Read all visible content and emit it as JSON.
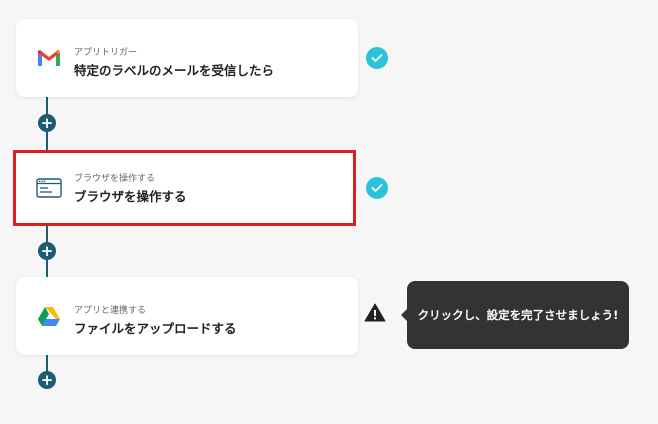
{
  "steps": [
    {
      "small_label": "アプリトリガー",
      "main_label": "特定のラベルのメールを受信したら",
      "icon": "gmail-icon",
      "status": "complete"
    },
    {
      "small_label": "ブラウザを操作する",
      "main_label": "ブラウザを操作する",
      "icon": "browser-window-icon",
      "status": "complete",
      "highlighted": true
    },
    {
      "small_label": "アプリと連携する",
      "main_label": "ファイルをアップロードする",
      "icon": "google-drive-icon",
      "status": "warning"
    }
  ],
  "add_step_symbol": "+",
  "tooltip": {
    "text": "クリックし、設定を完了させましょう!"
  },
  "colors": {
    "check": "#2bc3d9",
    "connector": "#1c5d74",
    "highlight_border": "#dd1f1f",
    "tooltip_bg": "#333333"
  }
}
